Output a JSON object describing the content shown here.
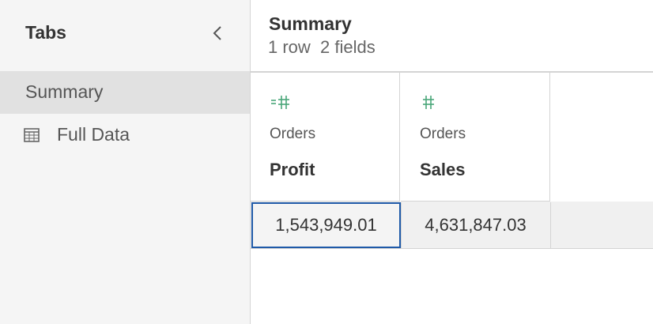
{
  "sidebar": {
    "title": "Tabs",
    "items": [
      {
        "label": "Summary",
        "active": true
      },
      {
        "label": "Full Data",
        "icon": "table-icon"
      }
    ]
  },
  "main": {
    "title": "Summary",
    "subtitle": "1 row  2 fields",
    "columns": [
      {
        "type_icon": "measure-calculated-icon",
        "source": "Orders",
        "name": "Profit"
      },
      {
        "type_icon": "number-icon",
        "source": "Orders",
        "name": "Sales"
      }
    ],
    "rows": [
      [
        "1,543,949.01",
        "4,631,847.03"
      ]
    ]
  },
  "colors": {
    "type_icon": "#4aa77a",
    "selection": "#1f5aa8",
    "active_item": "#e1e1e1"
  }
}
